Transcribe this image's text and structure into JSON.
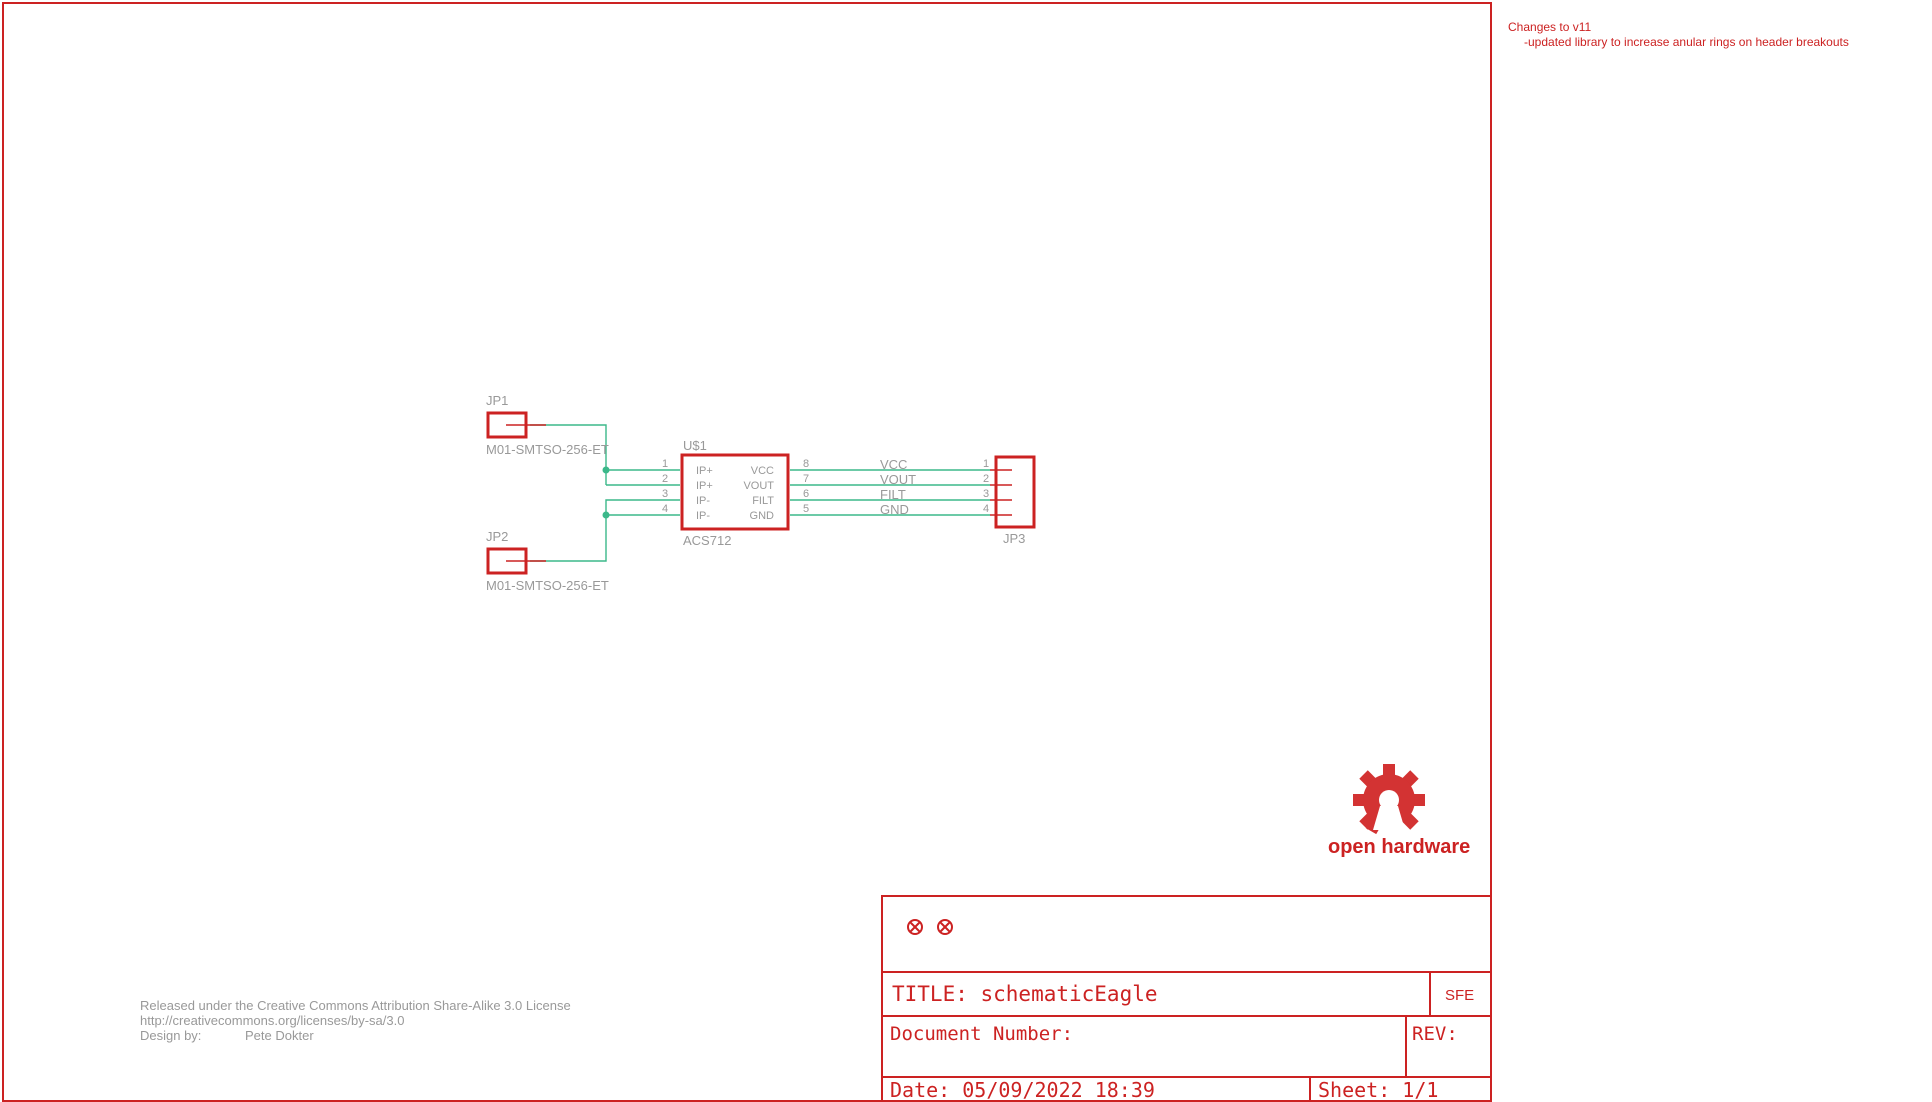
{
  "notes": {
    "line1": "Changes to v11",
    "line2": "-updated library to increase anular rings on header breakouts"
  },
  "license": {
    "line1": "Released under the Creative Commons Attribution Share-Alike 3.0 License",
    "line2": "http://creativecommons.org/licenses/by-sa/3.0",
    "design_by_label": "Design by:",
    "designer": "Pete Dokter"
  },
  "logo": {
    "text": "open hardware"
  },
  "title_block": {
    "title": "TITLE: schematicEagle",
    "company": "SFE",
    "document_number": "Document Number:",
    "rev": "REV:",
    "date": "Date: 05/09/2022 18:39",
    "sheet": "Sheet: 1/1"
  },
  "parts": {
    "jp1": {
      "ref": "JP1",
      "value": "M01-SMTSO-256-ET"
    },
    "jp2": {
      "ref": "JP2",
      "value": "M01-SMTSO-256-ET"
    },
    "jp3": {
      "ref": "JP3",
      "pins": [
        "1",
        "2",
        "3",
        "4"
      ]
    },
    "u1": {
      "ref": "U$1",
      "value": "ACS712",
      "left_pins": [
        {
          "num": "1",
          "name": "IP+"
        },
        {
          "num": "2",
          "name": "IP+"
        },
        {
          "num": "3",
          "name": "IP-"
        },
        {
          "num": "4",
          "name": "IP-"
        }
      ],
      "right_pins": [
        {
          "num": "8",
          "name": "VCC"
        },
        {
          "num": "7",
          "name": "VOUT"
        },
        {
          "num": "6",
          "name": "FILT"
        },
        {
          "num": "5",
          "name": "GND"
        }
      ]
    }
  },
  "nets": [
    "VCC",
    "VOUT",
    "FILT",
    "GND"
  ],
  "colors": {
    "frame": "#cc2222",
    "wire": "#3cb88a",
    "label": "#999999"
  }
}
